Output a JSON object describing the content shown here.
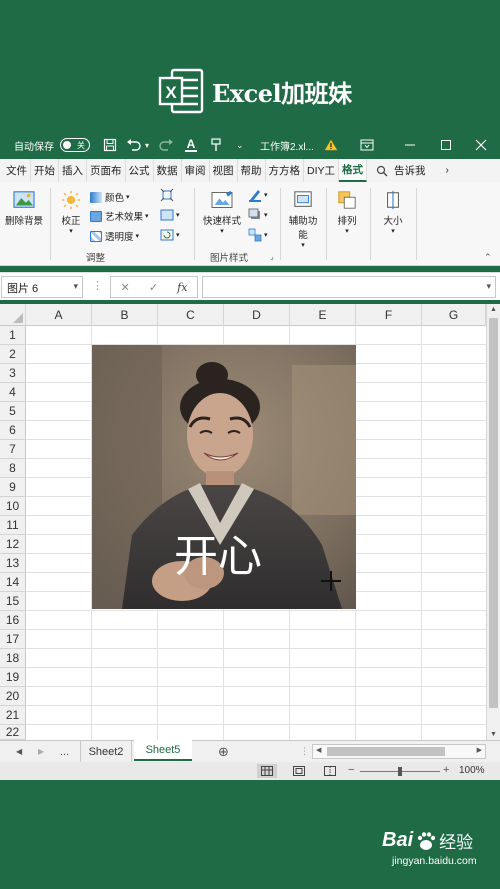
{
  "banner": {
    "logo_letter": "X",
    "title": "Excel加班妹"
  },
  "titlebar": {
    "autosave_label": "自动保存",
    "autosave_state": "关",
    "filename": "工作簿2.xl...",
    "warning_icon": "warning-icon"
  },
  "tabs": [
    "文件",
    "开始",
    "插入",
    "页面布",
    "公式",
    "数据",
    "审阅",
    "视图",
    "帮助",
    "方方格",
    "DIY工",
    "格式"
  ],
  "active_tab": "格式",
  "tell_me": "告诉我",
  "ribbon": {
    "remove_bg": "删除背景",
    "correct": "校正",
    "color": "颜色",
    "art_effects": "艺术效果",
    "transparency": "透明度",
    "adjust_group": "调整",
    "quick_styles": "快速样式",
    "pic_styles_group": "图片样式",
    "accessibility_1": "辅助功",
    "accessibility_2": "能",
    "arrange": "排列",
    "size": "大小"
  },
  "formula_bar": {
    "name_box": "图片 6",
    "cancel": "✕",
    "confirm": "✓",
    "fx": "fx"
  },
  "columns": [
    "A",
    "B",
    "C",
    "D",
    "E",
    "F",
    "G"
  ],
  "rows": [
    "1",
    "2",
    "3",
    "4",
    "5",
    "6",
    "7",
    "8",
    "9",
    "10",
    "11",
    "12",
    "13",
    "14",
    "15",
    "16",
    "17",
    "18",
    "19",
    "20",
    "21",
    "22"
  ],
  "picture": {
    "caption": "开心"
  },
  "sheet_tabs": {
    "ellipsis": "...",
    "tab1": "Sheet2",
    "tab2": "Sheet5",
    "add": "⊕"
  },
  "status": {
    "zoom": "100%"
  },
  "watermark": {
    "text": "Bai",
    "text2": "经验",
    "url": "jingyan.baidu.com"
  },
  "colors": {
    "brand_green": "#1e6b45",
    "active_tab": "#1e6b45"
  }
}
